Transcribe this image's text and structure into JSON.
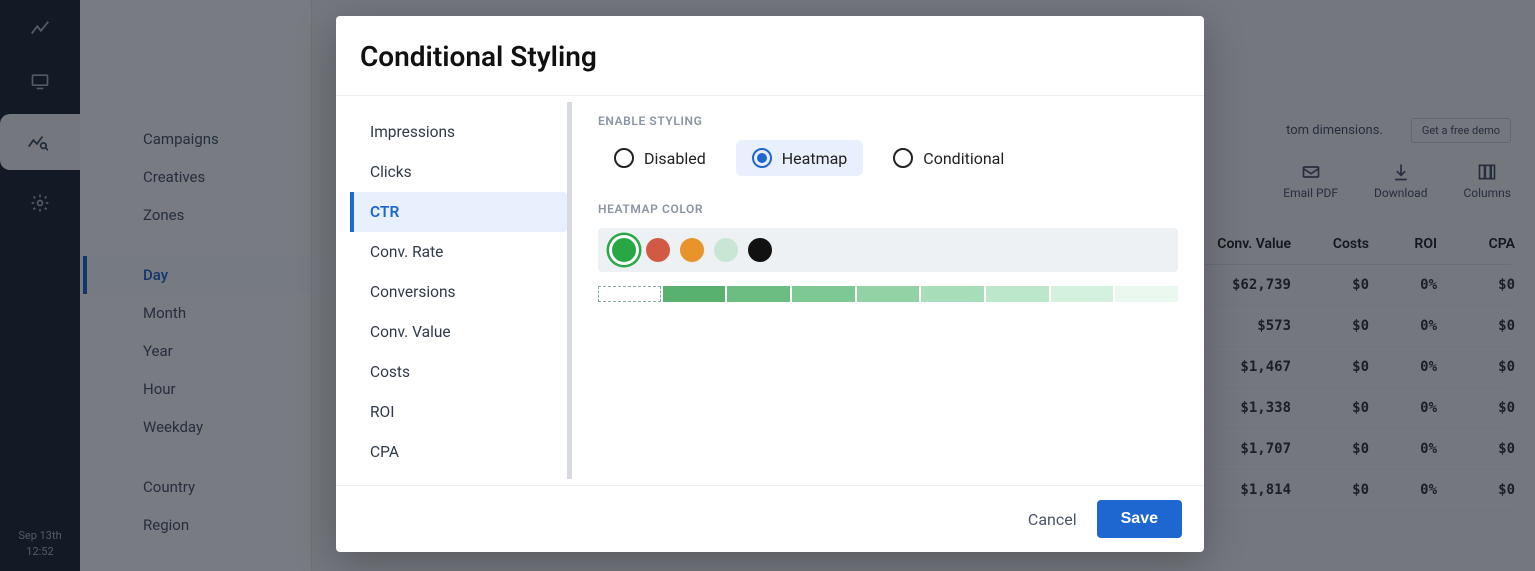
{
  "rail": {
    "date": "Sep 13th",
    "time": "12:52"
  },
  "sidebar": {
    "groups": [
      [
        "Campaigns",
        "Creatives",
        "Zones"
      ],
      [
        "Day",
        "Month",
        "Year",
        "Hour",
        "Weekday"
      ],
      [
        "Country",
        "Region"
      ]
    ],
    "active": "Day"
  },
  "banner": {
    "text": "tom dimensions.",
    "cta": "Get a free demo"
  },
  "toolbar": {
    "email_pdf": "Email PDF",
    "download": "Download",
    "columns": "Columns"
  },
  "table": {
    "headers": [
      "Conv. Value",
      "Costs",
      "ROI",
      "CPA"
    ],
    "rows": [
      [
        "$62,739",
        "$0",
        "0%",
        "$0"
      ],
      [
        "$573",
        "$0",
        "0%",
        "$0"
      ],
      [
        "$1,467",
        "$0",
        "0%",
        "$0"
      ],
      [
        "$1,338",
        "$0",
        "0%",
        "$0"
      ],
      [
        "$1,707",
        "$0",
        "0%",
        "$0"
      ],
      [
        "$1,814",
        "$0",
        "0%",
        "$0"
      ]
    ]
  },
  "modal": {
    "title": "Conditional Styling",
    "metrics": [
      "Impressions",
      "Clicks",
      "CTR",
      "Conv. Rate",
      "Conversions",
      "Conv. Value",
      "Costs",
      "ROI",
      "CPA"
    ],
    "active_metric": "CTR",
    "enable_label": "ENABLE STYLING",
    "options": [
      "Disabled",
      "Heatmap",
      "Conditional"
    ],
    "selected_option": "Heatmap",
    "color_label": "HEATMAP COLOR",
    "colors": [
      "#27a844",
      "#d25a44",
      "#e8942a",
      "#c9e6d4",
      "#111111"
    ],
    "selected_color": "#27a844",
    "gradient": [
      "#ffffff",
      "#58b16f",
      "#6bbd82",
      "#7ec893",
      "#92d2a5",
      "#a7ddb8",
      "#bce7cb",
      "#d4f0de",
      "#eaf8f0"
    ],
    "cancel": "Cancel",
    "save": "Save"
  }
}
